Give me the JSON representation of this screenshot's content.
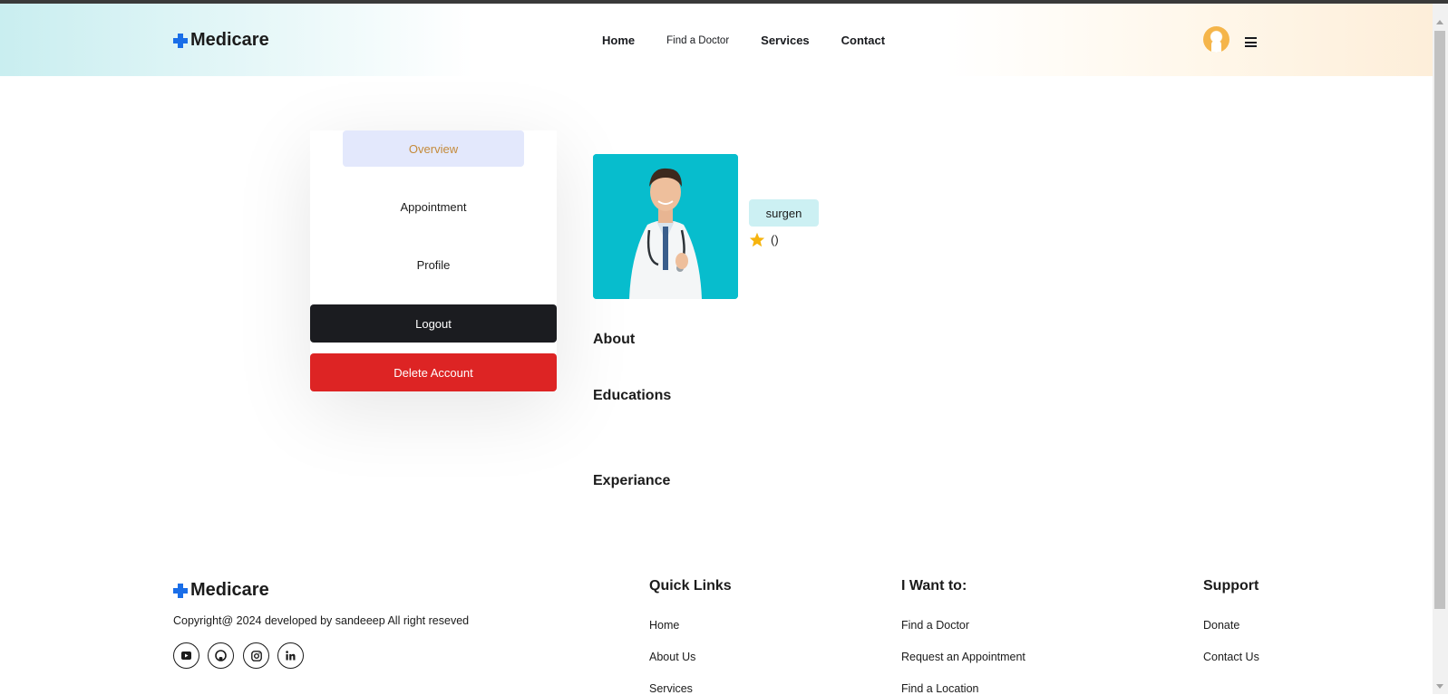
{
  "brand": {
    "name": "Medicare",
    "accent": "#1a6ee8"
  },
  "nav": {
    "items": [
      "Home",
      "Find a Doctor",
      "Services",
      "Contact"
    ]
  },
  "sidebar": {
    "overview": "Overview",
    "appointment": "Appointment",
    "profile": "Profile",
    "logout": "Logout",
    "delete": "Delete Account",
    "delete_color": "#dd2424"
  },
  "doctor": {
    "specialty": "surgen",
    "rating_text": "()",
    "star_color": "#f6b40e"
  },
  "sections": {
    "about": "About",
    "educations": "Educations",
    "experience": "Experiance"
  },
  "footer": {
    "brand": "Medicare",
    "copyright": "Copyright@ 2024 developed by sandeeep All right reseved",
    "social": [
      "youtube-icon",
      "github-icon",
      "instagram-icon",
      "linkedin-icon"
    ],
    "quick_links": {
      "title": "Quick Links",
      "items": [
        "Home",
        "About Us",
        "Services"
      ]
    },
    "want_to": {
      "title": "I Want to:",
      "items": [
        "Find a Doctor",
        "Request an Appointment",
        "Find a Location"
      ]
    },
    "support": {
      "title": "Support",
      "items": [
        "Donate",
        "Contact Us"
      ]
    }
  }
}
